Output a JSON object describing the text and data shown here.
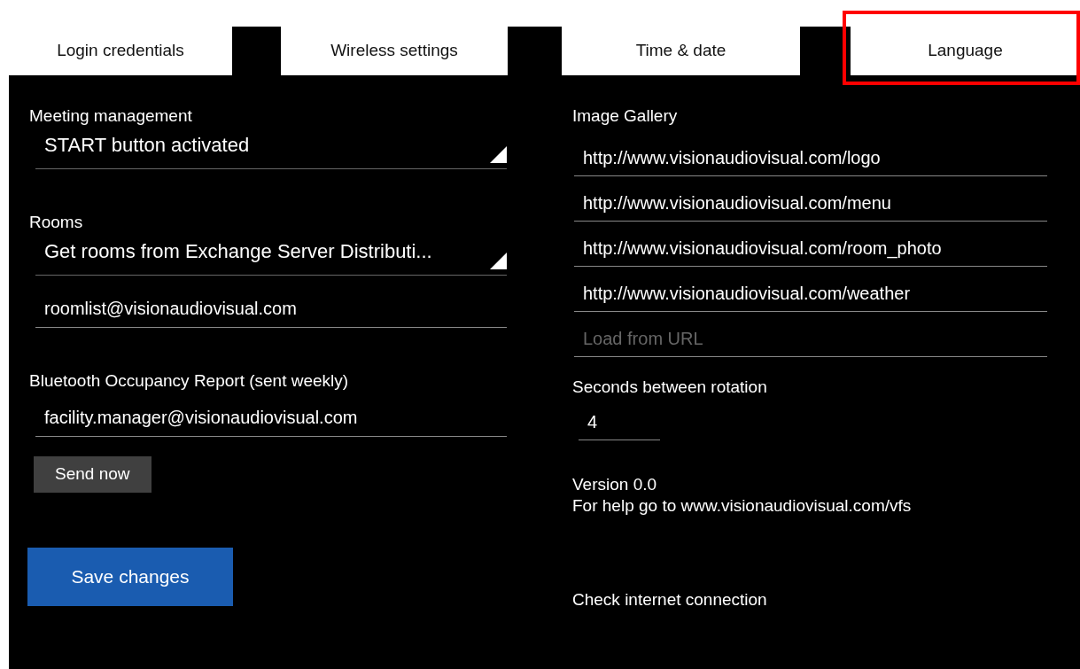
{
  "tabs": [
    {
      "label": "Login credentials",
      "highlighted": false
    },
    {
      "label": "Wireless settings",
      "highlighted": false
    },
    {
      "label": "Time & date",
      "highlighted": false
    },
    {
      "label": "Language",
      "highlighted": true
    }
  ],
  "left_sections": [
    {
      "label": "Meeting management",
      "fields": [
        {
          "kind": "dropdown",
          "value": "START button activated"
        }
      ]
    },
    {
      "label": "Rooms",
      "fields": [
        {
          "kind": "dropdown",
          "value": "Get rooms from Exchange Server Distributi..."
        },
        {
          "kind": "text",
          "value": "roomlist@visionaudiovisual.com"
        }
      ]
    },
    {
      "label": "Bluetooth Occupancy Report (sent weekly)",
      "fields": [
        {
          "kind": "text",
          "value": "facility.manager@visionaudiovisual.com"
        }
      ],
      "button": "Send now"
    }
  ],
  "save_button": "Save changes",
  "image_gallery": {
    "label": "Image Gallery",
    "urls": [
      "http://www.visionaudiovisual.com/logo",
      "http://www.visionaudiovisual.com/menu",
      "http://www.visionaudiovisual.com/room_photo",
      "http://www.visionaudiovisual.com/weather"
    ],
    "placeholder": "Load from URL"
  },
  "rotation": {
    "label": "Seconds between rotation",
    "value": "4"
  },
  "version": "Version 0.0",
  "help": "For help go to www.visionaudiovisual.com/vfs",
  "check_internet": "Check internet connection"
}
